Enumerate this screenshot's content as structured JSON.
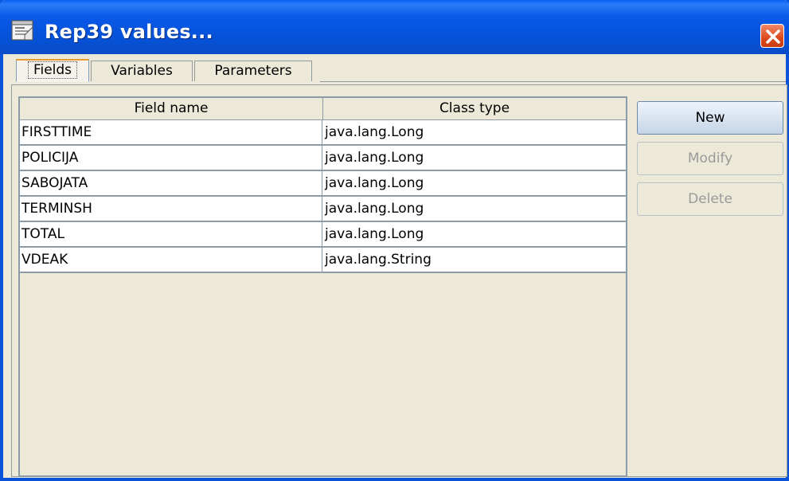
{
  "window": {
    "title": "Rep39 values...",
    "accent": "#0a53d8"
  },
  "tabs": [
    {
      "label": "Fields",
      "active": true
    },
    {
      "label": "Variables",
      "active": false
    },
    {
      "label": "Parameters",
      "active": false
    }
  ],
  "table": {
    "columns": [
      "Field name",
      "Class type"
    ],
    "rows": [
      [
        "FIRSTTIME",
        "java.lang.Long"
      ],
      [
        "POLICIJA",
        "java.lang.Long"
      ],
      [
        "SABOJATA",
        "java.lang.Long"
      ],
      [
        "TERMINSH",
        "java.lang.Long"
      ],
      [
        "TOTAL",
        "java.lang.Long"
      ],
      [
        "VDEAK",
        "java.lang.String"
      ]
    ]
  },
  "buttons": {
    "new": "New",
    "modify": "Modify",
    "delete": "Delete"
  }
}
